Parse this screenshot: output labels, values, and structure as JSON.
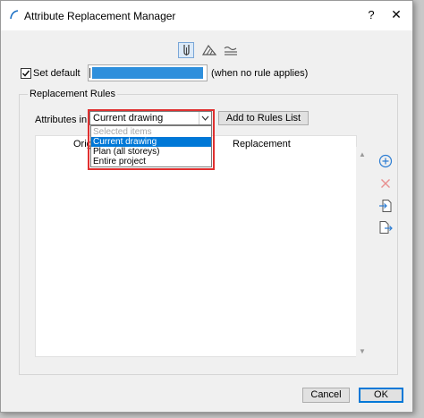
{
  "window": {
    "title": "Attribute Replacement Manager",
    "help_glyph": "?",
    "close_glyph": "✕"
  },
  "toolbar": {
    "icons": [
      "pen-icon",
      "hatch-icon",
      "surface-icon"
    ],
    "selected": "pen-icon"
  },
  "set_default": {
    "label": "Set default",
    "checked": true,
    "swatch_color": "#2e8fdc",
    "note": "(when no rule applies)"
  },
  "replacement_rules": {
    "group_label": "Replacement Rules",
    "attributes_in_label": "Attributes in",
    "selected_value": "Current drawing",
    "add_button_label": "Add to Rules List",
    "dropdown_options": [
      "Selected items",
      "Current drawing",
      "Plan (all storeys)",
      "Entire project"
    ],
    "dropdown_highlighted": "Current drawing",
    "columns": {
      "original": "Orig",
      "replacement": "Replacement"
    }
  },
  "side_actions": [
    "add-rule-icon",
    "delete-rule-icon",
    "import-icon",
    "export-icon"
  ],
  "footer": {
    "cancel_label": "Cancel",
    "ok_label": "OK"
  },
  "colors": {
    "accent": "#0078d7",
    "highlight_box": "#e03030"
  }
}
